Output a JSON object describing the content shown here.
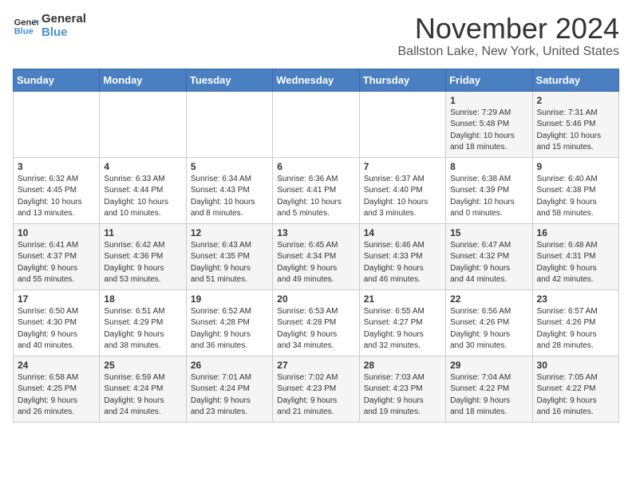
{
  "header": {
    "logo_line1": "General",
    "logo_line2": "Blue",
    "title": "November 2024",
    "subtitle": "Ballston Lake, New York, United States"
  },
  "days_of_week": [
    "Sunday",
    "Monday",
    "Tuesday",
    "Wednesday",
    "Thursday",
    "Friday",
    "Saturday"
  ],
  "weeks": [
    [
      {
        "day": "",
        "info": ""
      },
      {
        "day": "",
        "info": ""
      },
      {
        "day": "",
        "info": ""
      },
      {
        "day": "",
        "info": ""
      },
      {
        "day": "",
        "info": ""
      },
      {
        "day": "1",
        "info": "Sunrise: 7:29 AM\nSunset: 5:48 PM\nDaylight: 10 hours\nand 18 minutes."
      },
      {
        "day": "2",
        "info": "Sunrise: 7:31 AM\nSunset: 5:46 PM\nDaylight: 10 hours\nand 15 minutes."
      }
    ],
    [
      {
        "day": "3",
        "info": "Sunrise: 6:32 AM\nSunset: 4:45 PM\nDaylight: 10 hours\nand 13 minutes."
      },
      {
        "day": "4",
        "info": "Sunrise: 6:33 AM\nSunset: 4:44 PM\nDaylight: 10 hours\nand 10 minutes."
      },
      {
        "day": "5",
        "info": "Sunrise: 6:34 AM\nSunset: 4:43 PM\nDaylight: 10 hours\nand 8 minutes."
      },
      {
        "day": "6",
        "info": "Sunrise: 6:36 AM\nSunset: 4:41 PM\nDaylight: 10 hours\nand 5 minutes."
      },
      {
        "day": "7",
        "info": "Sunrise: 6:37 AM\nSunset: 4:40 PM\nDaylight: 10 hours\nand 3 minutes."
      },
      {
        "day": "8",
        "info": "Sunrise: 6:38 AM\nSunset: 4:39 PM\nDaylight: 10 hours\nand 0 minutes."
      },
      {
        "day": "9",
        "info": "Sunrise: 6:40 AM\nSunset: 4:38 PM\nDaylight: 9 hours\nand 58 minutes."
      }
    ],
    [
      {
        "day": "10",
        "info": "Sunrise: 6:41 AM\nSunset: 4:37 PM\nDaylight: 9 hours\nand 55 minutes."
      },
      {
        "day": "11",
        "info": "Sunrise: 6:42 AM\nSunset: 4:36 PM\nDaylight: 9 hours\nand 53 minutes."
      },
      {
        "day": "12",
        "info": "Sunrise: 6:43 AM\nSunset: 4:35 PM\nDaylight: 9 hours\nand 51 minutes."
      },
      {
        "day": "13",
        "info": "Sunrise: 6:45 AM\nSunset: 4:34 PM\nDaylight: 9 hours\nand 49 minutes."
      },
      {
        "day": "14",
        "info": "Sunrise: 6:46 AM\nSunset: 4:33 PM\nDaylight: 9 hours\nand 46 minutes."
      },
      {
        "day": "15",
        "info": "Sunrise: 6:47 AM\nSunset: 4:32 PM\nDaylight: 9 hours\nand 44 minutes."
      },
      {
        "day": "16",
        "info": "Sunrise: 6:48 AM\nSunset: 4:31 PM\nDaylight: 9 hours\nand 42 minutes."
      }
    ],
    [
      {
        "day": "17",
        "info": "Sunrise: 6:50 AM\nSunset: 4:30 PM\nDaylight: 9 hours\nand 40 minutes."
      },
      {
        "day": "18",
        "info": "Sunrise: 6:51 AM\nSunset: 4:29 PM\nDaylight: 9 hours\nand 38 minutes."
      },
      {
        "day": "19",
        "info": "Sunrise: 6:52 AM\nSunset: 4:28 PM\nDaylight: 9 hours\nand 36 minutes."
      },
      {
        "day": "20",
        "info": "Sunrise: 6:53 AM\nSunset: 4:28 PM\nDaylight: 9 hours\nand 34 minutes."
      },
      {
        "day": "21",
        "info": "Sunrise: 6:55 AM\nSunset: 4:27 PM\nDaylight: 9 hours\nand 32 minutes."
      },
      {
        "day": "22",
        "info": "Sunrise: 6:56 AM\nSunset: 4:26 PM\nDaylight: 9 hours\nand 30 minutes."
      },
      {
        "day": "23",
        "info": "Sunrise: 6:57 AM\nSunset: 4:26 PM\nDaylight: 9 hours\nand 28 minutes."
      }
    ],
    [
      {
        "day": "24",
        "info": "Sunrise: 6:58 AM\nSunset: 4:25 PM\nDaylight: 9 hours\nand 26 minutes."
      },
      {
        "day": "25",
        "info": "Sunrise: 6:59 AM\nSunset: 4:24 PM\nDaylight: 9 hours\nand 24 minutes."
      },
      {
        "day": "26",
        "info": "Sunrise: 7:01 AM\nSunset: 4:24 PM\nDaylight: 9 hours\nand 23 minutes."
      },
      {
        "day": "27",
        "info": "Sunrise: 7:02 AM\nSunset: 4:23 PM\nDaylight: 9 hours\nand 21 minutes."
      },
      {
        "day": "28",
        "info": "Sunrise: 7:03 AM\nSunset: 4:23 PM\nDaylight: 9 hours\nand 19 minutes."
      },
      {
        "day": "29",
        "info": "Sunrise: 7:04 AM\nSunset: 4:22 PM\nDaylight: 9 hours\nand 18 minutes."
      },
      {
        "day": "30",
        "info": "Sunrise: 7:05 AM\nSunset: 4:22 PM\nDaylight: 9 hours\nand 16 minutes."
      }
    ]
  ]
}
